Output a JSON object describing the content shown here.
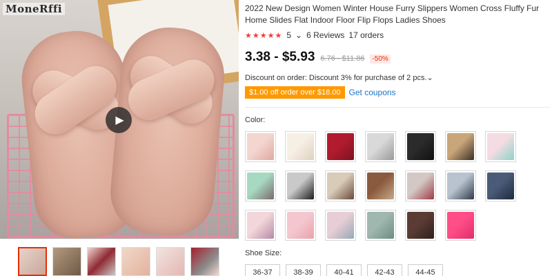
{
  "gallery": {
    "brand_logo": "MoneRffi",
    "play_icon": "play-icon",
    "thumbnail_count": 6
  },
  "product": {
    "title": "2022 New Design Women Winter House Furry Slippers Women Cross Fluffy Fur Home Slides Flat Indoor Floor Flip Flops Ladies Shoes",
    "rating_stars": "★★★★★",
    "rating_value": "5",
    "rating_chevron": "⌄",
    "reviews": "6 Reviews",
    "orders": "17 orders"
  },
  "pricing": {
    "price": "3.38 - $5.93",
    "original_price": "6.76 - $11.86",
    "discount": "-50%",
    "discount_text": "Discount on order: Discount 3% for purchase of 2 pcs.⌄",
    "coupon_badge": "$1.00 off order over $18.00",
    "get_coupons": "Get coupons"
  },
  "color": {
    "label": "Color:",
    "swatches": [
      {
        "c1": "#f3d6d0",
        "c2": "#e0a9a0"
      },
      {
        "c1": "#f6efe4",
        "c2": "#ded2bf"
      },
      {
        "c1": "#b01c2e",
        "c2": "#7d1320"
      },
      {
        "c1": "#d9d9d9",
        "c2": "#9a9a9a"
      },
      {
        "c1": "#2b2b2b",
        "c2": "#111111"
      },
      {
        "c1": "#c9a57a",
        "c2": "#3d3027"
      },
      {
        "c1": "#f5dce2",
        "c2": "#8fd2c8"
      },
      {
        "c1": "#a6d8c2",
        "c2": "#7a6b6b"
      },
      {
        "c1": "#c9c9c9",
        "c2": "#1c1c1c"
      },
      {
        "c1": "#d8cbb8",
        "c2": "#6b4a3a"
      },
      {
        "c1": "#8a5a3e",
        "c2": "#c7a987"
      },
      {
        "c1": "#d4c8c4",
        "c2": "#9c3b46"
      },
      {
        "c1": "#b9c3cf",
        "c2": "#2f3a4a"
      },
      {
        "c1": "#4a5b78",
        "c2": "#1f2a3d"
      },
      {
        "c1": "#f2d6da",
        "c2": "#b58aa5"
      },
      {
        "c1": "#f4c7cf",
        "c2": "#e9a3ad"
      },
      {
        "c1": "#e7cdd5",
        "c2": "#97a9b5"
      },
      {
        "c1": "#9fb7ae",
        "c2": "#6d8b82"
      },
      {
        "c1": "#5b3c34",
        "c2": "#2e1f1b"
      },
      {
        "c1": "#ff4d88",
        "c2": "#e02e6b"
      }
    ]
  },
  "size": {
    "label": "Shoe Size:",
    "options": [
      "36-37",
      "38-39",
      "40-41",
      "42-43",
      "44-45"
    ]
  }
}
